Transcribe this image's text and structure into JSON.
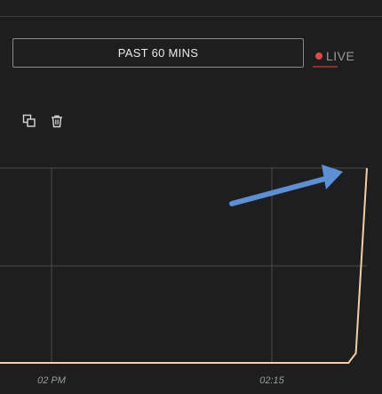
{
  "header": {
    "range_label": "PAST 60 MINS",
    "live_label": "LIVE"
  },
  "toolbar": {
    "icons": [
      "duplicate-icon",
      "trash-icon"
    ]
  },
  "chart_data": {
    "type": "line",
    "x_ticks": [
      "02 PM",
      "02:15"
    ],
    "series": [
      {
        "points": [
          [
            0,
            0
          ],
          [
            0.95,
            0
          ],
          [
            0.97,
            0.05
          ],
          [
            1.0,
            1.0
          ]
        ],
        "color": "#f5cfa6"
      }
    ],
    "grid": true
  },
  "colors": {
    "background": "#1e1e1e",
    "line": "#f5cfa6",
    "live": "#e04848",
    "arrow": "#5b8fd6"
  }
}
